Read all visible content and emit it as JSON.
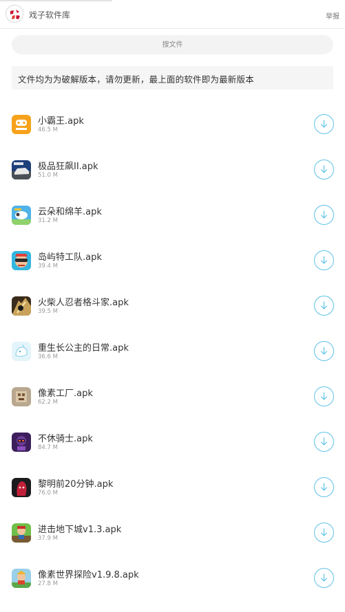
{
  "header": {
    "app_title": "戏子软件库",
    "report_label": "举报"
  },
  "search": {
    "placeholder": "搜文件"
  },
  "notice": {
    "text": "文件均为为破解版本，请勿更新，最上面的软件即为最新版本"
  },
  "colors": {
    "accent": "#5ec3e6",
    "notice_bg": "#f5f5f5",
    "search_bg": "#f3f3f3"
  },
  "files": [
    {
      "name": "小霸王.apk",
      "size": "46.5 M",
      "icon": "xiaobawang-icon"
    },
    {
      "name": "极品狂飙II.apk",
      "size": "51.0 M",
      "icon": "racing-car-icon"
    },
    {
      "name": "云朵和绵羊.apk",
      "size": "31.2 M",
      "icon": "sheep-icon"
    },
    {
      "name": "岛屿特工队.apk",
      "size": "39.4 M",
      "icon": "agent-icon"
    },
    {
      "name": "火柴人忍者格斗家.apk",
      "size": "39.5 M",
      "icon": "ninja-icon"
    },
    {
      "name": "重生长公主的日常.apk",
      "size": "36.6 M",
      "icon": "princess-icon"
    },
    {
      "name": "像素工厂.apk",
      "size": "62.2 M",
      "icon": "pixel-factory-icon"
    },
    {
      "name": "不休骑士.apk",
      "size": "84.7 M",
      "icon": "knight-icon"
    },
    {
      "name": "黎明前20分钟.apk",
      "size": "76.0 M",
      "icon": "dawn-icon"
    },
    {
      "name": "进击地下城v1.3.apk",
      "size": "37.9 M",
      "icon": "dungeon-icon"
    },
    {
      "name": "像素世界探险v1.9.8.apk",
      "size": "27.8 M",
      "icon": "pixel-world-icon"
    }
  ]
}
